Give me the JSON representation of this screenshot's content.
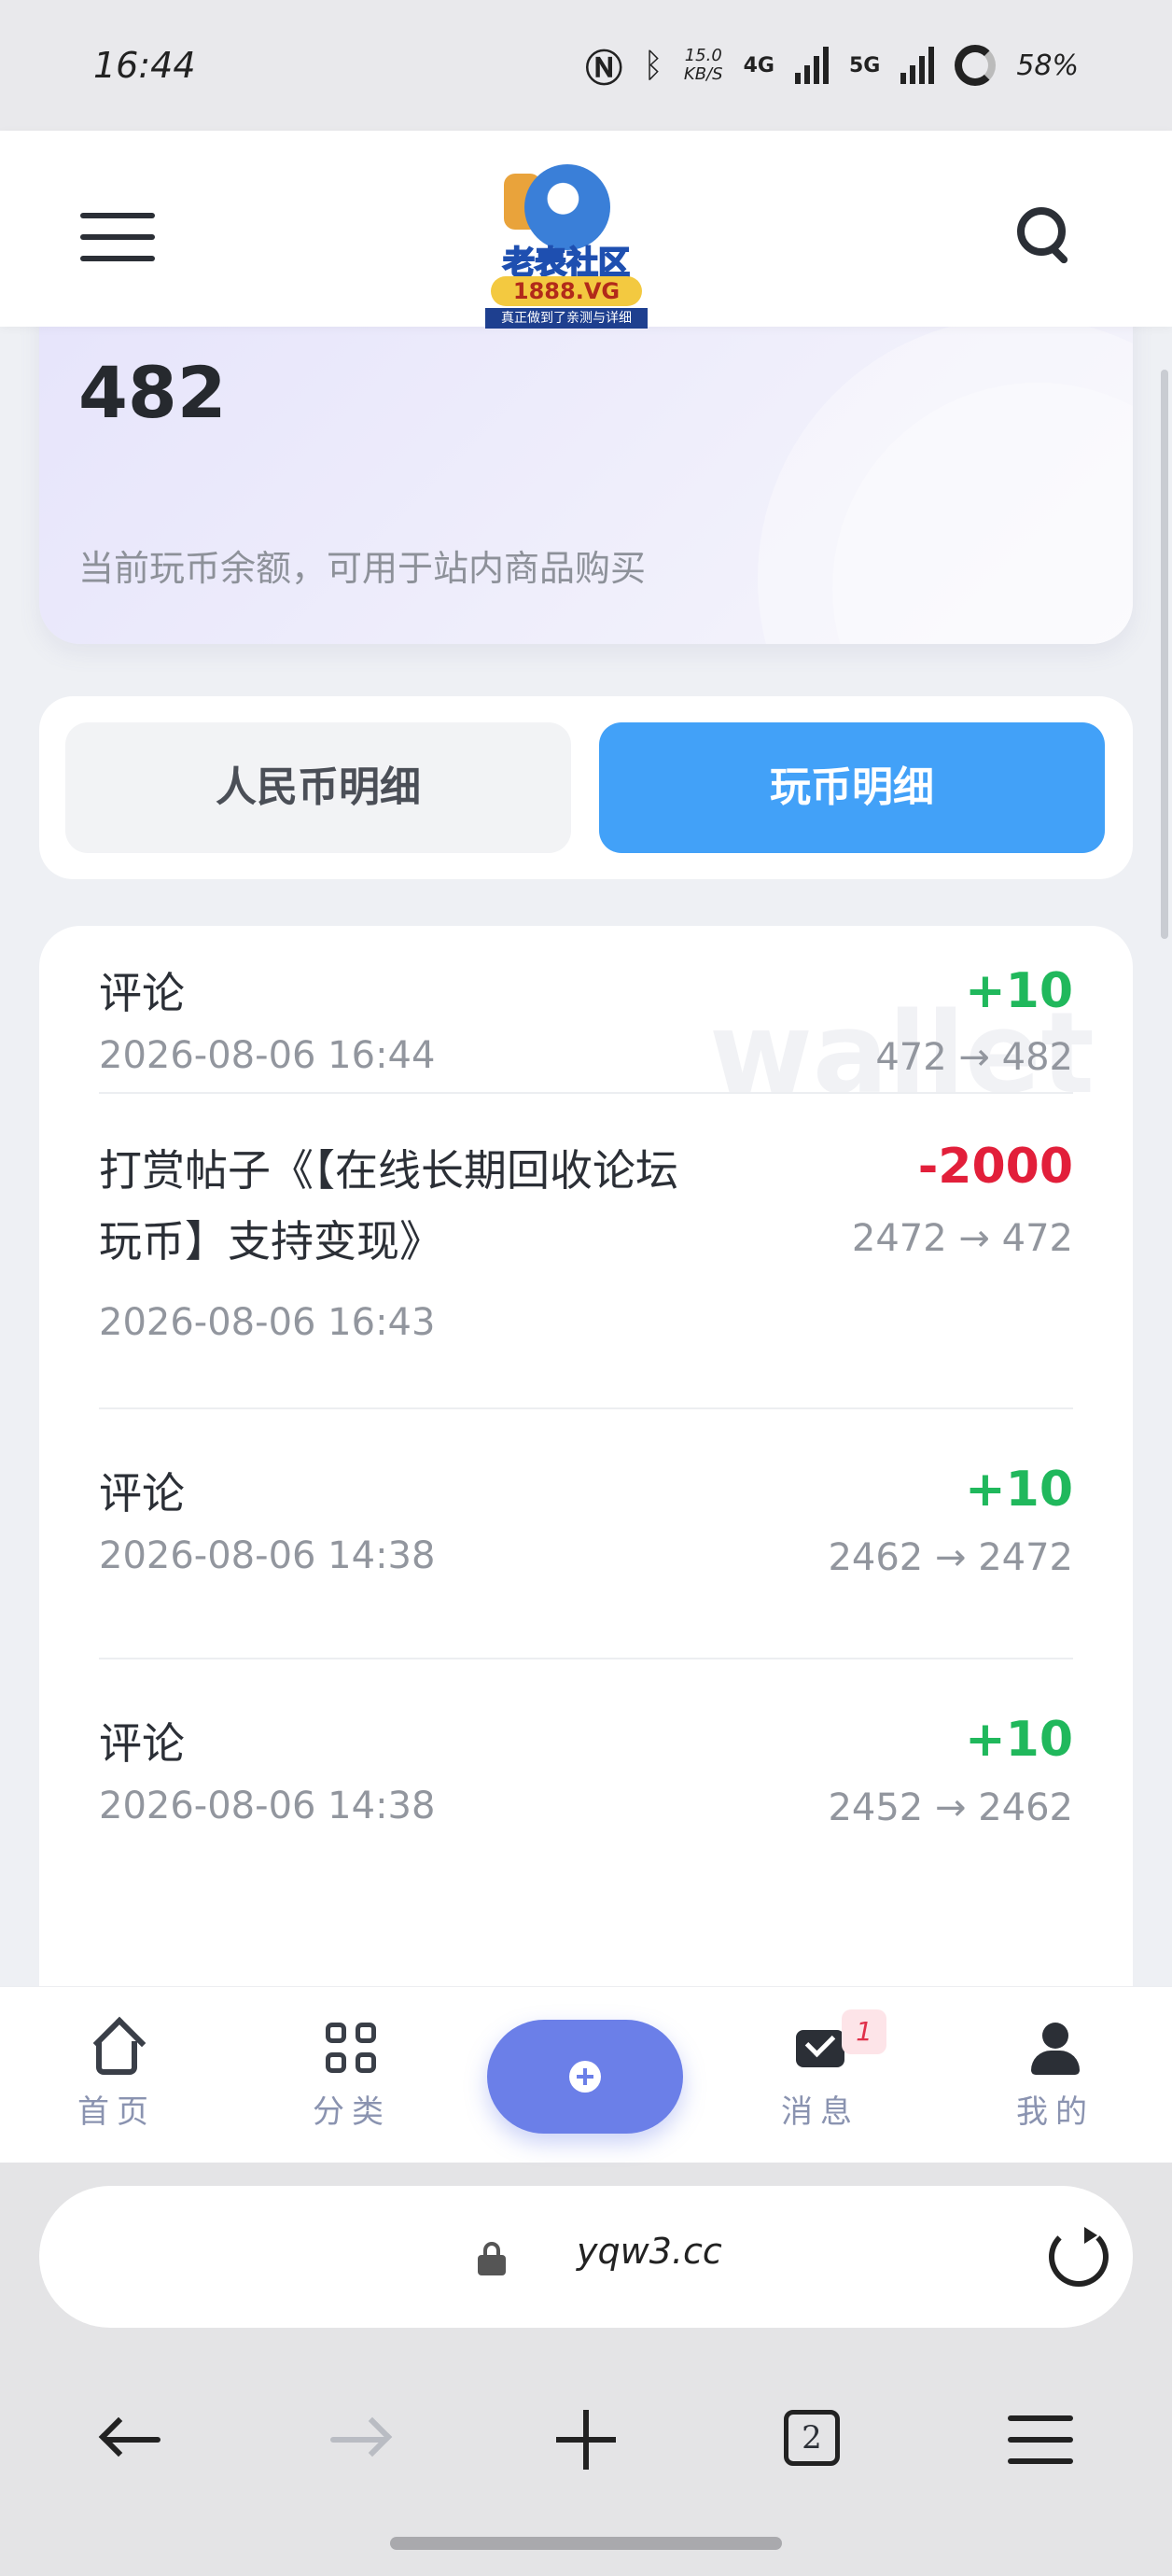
{
  "status_bar": {
    "time": "16:44",
    "net_speed_value": "15.0",
    "net_speed_unit": "KB/S",
    "network_4g": "4G",
    "network_5g": "5G",
    "battery": "58%"
  },
  "header": {
    "logo_title": "老表社区",
    "logo_domain": "1888.VG",
    "logo_tagline": "真正做到了亲测与详细"
  },
  "balance": {
    "amount": "482",
    "description": "当前玩币余额，可用于站内商品购买"
  },
  "tabs": [
    {
      "label": "人民币明细",
      "active": false
    },
    {
      "label": "玩币明细",
      "active": true
    }
  ],
  "records_watermark": "wallet",
  "records": [
    {
      "title": "评论",
      "time": "2026-08-06 16:44",
      "amount": "+10",
      "change": "472 → 482"
    },
    {
      "title_line1": "打赏帖子《【在线长期回收论坛",
      "title_line2": "玩币】支持变现》",
      "time": "2026-08-06 16:43",
      "amount": "-2000",
      "change": "2472 → 472"
    },
    {
      "title": "评论",
      "time": "2026-08-06 14:38",
      "amount": "+10",
      "change": "2462 → 2472"
    },
    {
      "title": "评论",
      "time": "2026-08-06 14:38",
      "amount": "+10",
      "change": "2452 → 2462"
    }
  ],
  "bottom_nav": {
    "home": "首页",
    "category": "分类",
    "messages": "消息",
    "messages_badge": "1",
    "mine": "我的"
  },
  "browser": {
    "url": "yqw3.cc",
    "tab_count": "2"
  },
  "colors": {
    "accent_tab": "#42a1f8",
    "fab": "#6b7fe8",
    "positive": "#20b85c",
    "negative": "#e21f3a"
  }
}
